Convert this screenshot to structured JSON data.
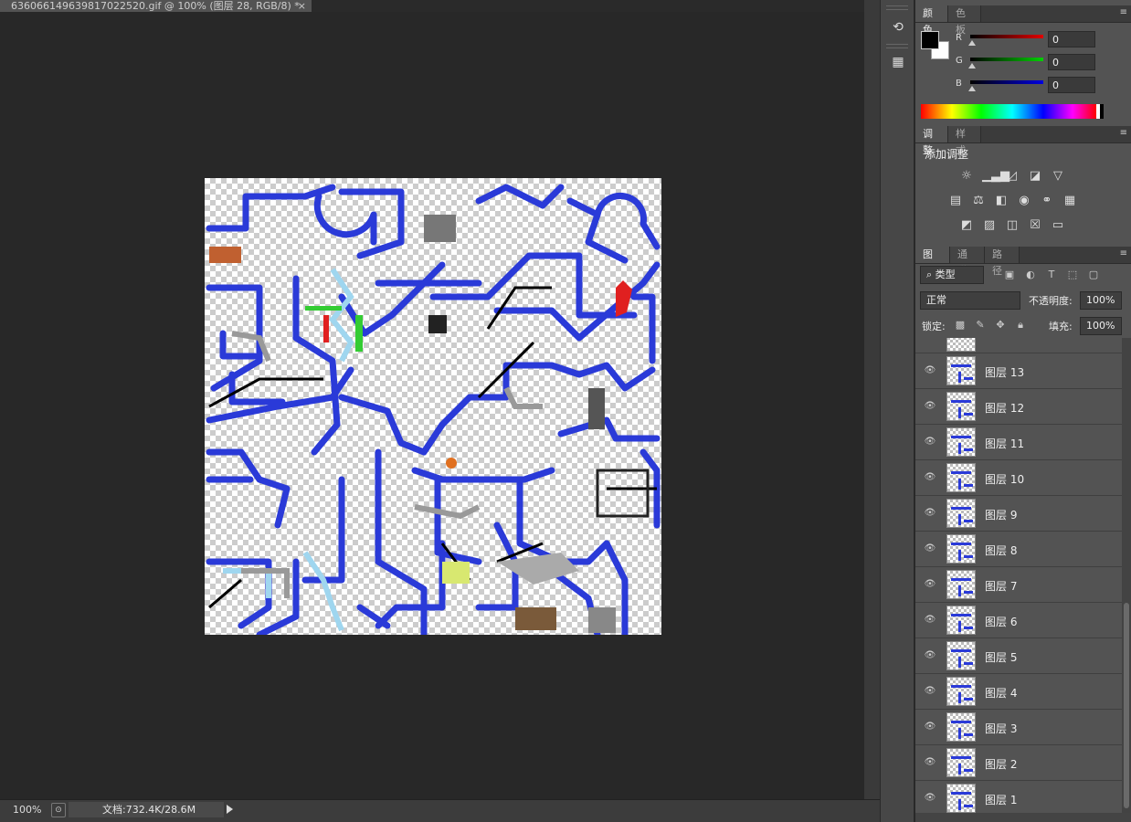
{
  "document": {
    "tab_title": "636066149639817022520.gif @ 100% (图层 28, RGB/8) *",
    "close_glyph": "×"
  },
  "status": {
    "zoom": "100%",
    "doc_info": "文档:732.4K/28.6M"
  },
  "color_panel": {
    "tabs": [
      "颜色",
      "色板"
    ],
    "foreground": "#000000",
    "background": "#ffffff",
    "channels": [
      {
        "label": "R",
        "value": "0",
        "color": "#e00000"
      },
      {
        "label": "G",
        "value": "0",
        "color": "#00d000"
      },
      {
        "label": "B",
        "value": "0",
        "color": "#0000e0"
      }
    ]
  },
  "adjustments_panel": {
    "tabs": [
      "调整",
      "样式"
    ],
    "title": "添加调整",
    "icons": [
      [
        "brightness-icon",
        "levels-icon",
        "curves-icon",
        "exposure-icon",
        "vibrance-icon"
      ],
      [
        "hue-saturation-icon",
        "color-balance-icon",
        "black-white-icon",
        "photo-filter-icon",
        "channel-mixer-icon",
        "color-lookup-icon"
      ],
      [
        "invert-icon",
        "posterize-icon",
        "threshold-icon",
        "selective-color-icon",
        "gradient-map-icon"
      ]
    ]
  },
  "layers_panel": {
    "tabs": [
      "图层",
      "通道",
      "路径"
    ],
    "filter_label": "类型",
    "blend_mode": "正常",
    "opacity_label": "不透明度:",
    "opacity": "100%",
    "lock_label": "锁定:",
    "fill_label": "填充:",
    "fill": "100%",
    "layers": [
      "图层 13",
      "图层 12",
      "图层 11",
      "图层 10",
      "图层 9",
      "图层 8",
      "图层 7",
      "图层 6",
      "图层 5",
      "图层 4",
      "图层 3",
      "图层 2",
      "图层 1"
    ]
  },
  "accent_color": "#2a3ad8"
}
